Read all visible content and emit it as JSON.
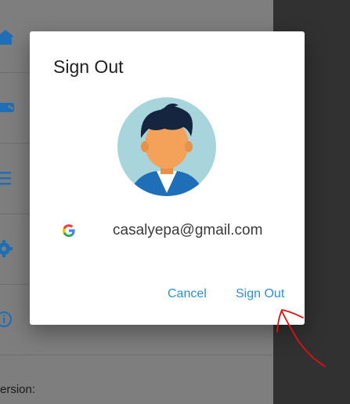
{
  "background": {
    "drawer_items": [
      {
        "icon": "home-icon"
      },
      {
        "icon": "gamepad-icon"
      },
      {
        "icon": "list-icon"
      },
      {
        "icon": "settings-icon"
      },
      {
        "icon": "info-icon"
      }
    ],
    "version_label": "ersion:"
  },
  "dialog": {
    "title": "Sign Out",
    "avatar_icon": "user-avatar-icon",
    "account_provider_icon": "google-icon",
    "account_email": "casalyepa@gmail.com",
    "cancel_label": "Cancel",
    "sign_out_label": "Sign Out"
  },
  "colors": {
    "accent": "#2f8fd6",
    "icon_blue": "#1e6fb5",
    "annotation": "#e01010",
    "avatar_bg": "#a8d4dc"
  }
}
